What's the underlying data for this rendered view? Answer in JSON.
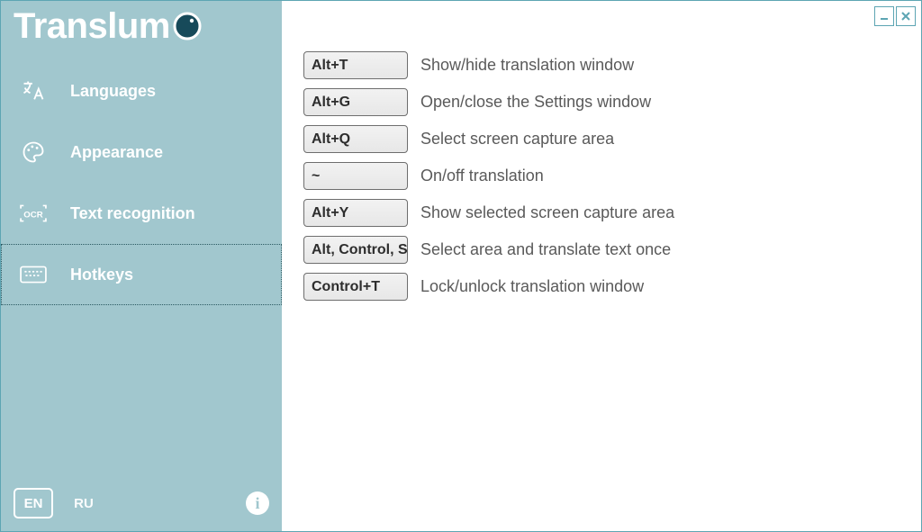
{
  "app": {
    "name_prefix": "Translum"
  },
  "sidebar": {
    "items": [
      {
        "label": "Languages",
        "icon": "translate-icon"
      },
      {
        "label": "Appearance",
        "icon": "palette-icon"
      },
      {
        "label": "Text recognition",
        "icon": "ocr-icon"
      },
      {
        "label": "Hotkeys",
        "icon": "keyboard-icon"
      }
    ],
    "active_index": 3,
    "lang_en": "EN",
    "lang_ru": "RU"
  },
  "hotkeys": [
    {
      "key": "Alt+T",
      "desc": "Show/hide translation window"
    },
    {
      "key": "Alt+G",
      "desc": "Open/close the Settings window"
    },
    {
      "key": "Alt+Q",
      "desc": "Select screen capture area"
    },
    {
      "key": "~",
      "desc": "On/off translation"
    },
    {
      "key": "Alt+Y",
      "desc": "Show selected screen capture area"
    },
    {
      "key": "Alt, Control, S",
      "desc": "Select area and translate text once"
    },
    {
      "key": "Control+T",
      "desc": "Lock/unlock translation window"
    }
  ]
}
